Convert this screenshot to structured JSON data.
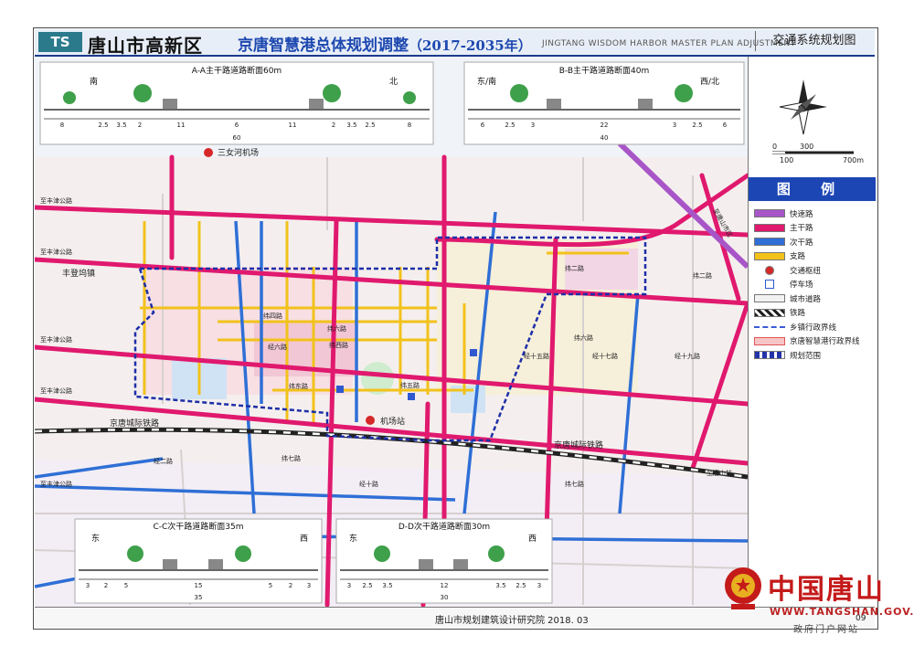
{
  "header": {
    "logo": "TS",
    "district": "唐山市高新区",
    "plan_title": "京唐智慧港总体规划调整",
    "plan_years": "（2017-2035年）",
    "plan_english": "JINGTANG WISDOM HARBOR MASTER PLAN ADJUSTMENT",
    "sheet_name": "交通系统规划图"
  },
  "sections": {
    "aa": {
      "title": "A-A主干路道路断面60m",
      "left_dir": "南",
      "right_dir": "北",
      "total": "60",
      "dims": [
        "8",
        "2.5",
        "3.5",
        "2",
        "11",
        "6",
        "11",
        "2",
        "3.5",
        "2.5",
        "8"
      ]
    },
    "bb": {
      "title": "B-B主干路道路断面40m",
      "left_dir": "东/南",
      "right_dir": "西/北",
      "total": "40",
      "dims": [
        "6",
        "2.5",
        "3",
        "22",
        "3",
        "2.5",
        "6"
      ]
    },
    "cc": {
      "title": "C-C次干路道路断面35m",
      "left_dir": "东",
      "right_dir": "西",
      "total": "35",
      "dims": [
        "3",
        "2",
        "5",
        "15",
        "5",
        "2",
        "3"
      ]
    },
    "dd": {
      "title": "D-D次干路道路断面30m",
      "left_dir": "东",
      "right_dir": "西",
      "total": "30",
      "dims": [
        "3",
        "2.5",
        "3.5",
        "12",
        "3.5",
        "2.5",
        "3"
      ]
    }
  },
  "map_labels": {
    "airport": "三女河机场",
    "town": "丰登坞镇",
    "rail_left": "京唐城际铁路",
    "rail_right": "京唐城际铁路",
    "station": "机场站",
    "hwy": "至唐山市区",
    "r1": "至丰津公路",
    "r2": "至丰津公路",
    "r3": "至丰津公路",
    "r4": "至丰津公路",
    "r5": "至丰津公路",
    "r6": "至唐山站",
    "w1": "纬二路",
    "w2": "纬四路",
    "w3": "纬六路",
    "w4": "纬七路",
    "w5": "纬西路",
    "w6": "纬东路",
    "w7": "纬五路",
    "w8": "纬六路",
    "w9": "纬七路",
    "w10": "纬二路",
    "j1": "经十五路",
    "j2": "经十七路",
    "j3": "经十九路",
    "j4": "经十路",
    "j5": "经二路",
    "j6": "经六路"
  },
  "compass": {
    "scale": [
      "0",
      "100",
      "300",
      "700m"
    ]
  },
  "legend": {
    "title": "图 例",
    "items": [
      {
        "label": "快速路",
        "color": "#a855c8"
      },
      {
        "label": "主干路",
        "color": "#e0196e"
      },
      {
        "label": "次干路",
        "color": "#2f6fd6"
      },
      {
        "label": "支路",
        "color": "#f2c21b"
      },
      {
        "label": "交通枢纽",
        "color": "#d62828"
      },
      {
        "label": "停车场",
        "color": "#2f58d0"
      },
      {
        "label": "城市道路",
        "color": "#bbbbbb"
      },
      {
        "label": "铁路",
        "color": "#222222"
      },
      {
        "label": "乡镇行政界线",
        "color": "#3b5bd6"
      },
      {
        "label": "京唐智慧港行政界线",
        "color": "#e05555"
      },
      {
        "label": "规划范围",
        "color": "#2233aa"
      }
    ]
  },
  "footer": {
    "institute": "唐山市规划建筑设计研究院  2018. 03",
    "page": "09"
  },
  "watermark": {
    "title": "中国唐山",
    "url": "WWW.TANGSHAN.GOV.CN",
    "sub": "政府门户网站"
  }
}
